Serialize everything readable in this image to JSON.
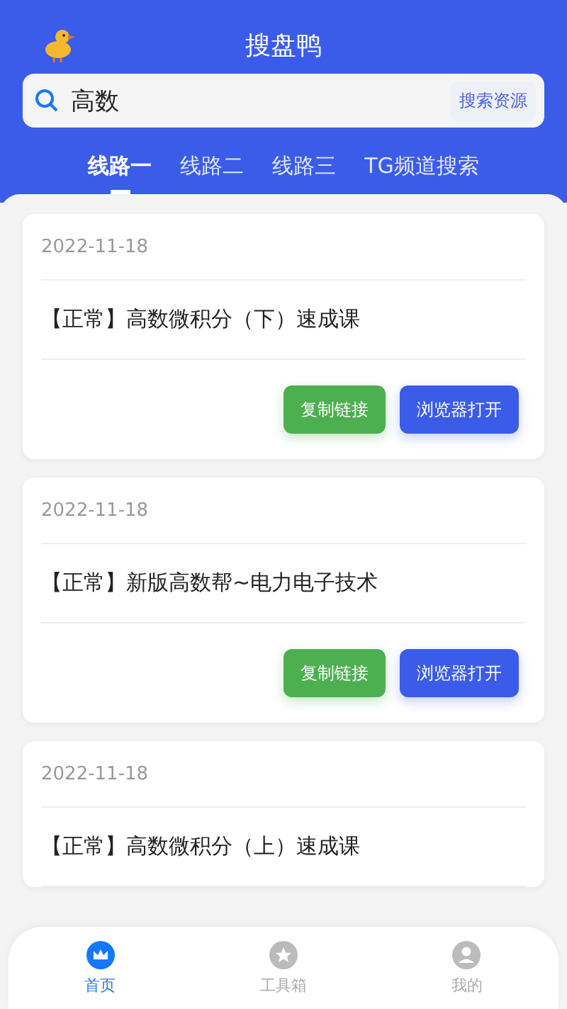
{
  "header": {
    "title": "搜盘鸭"
  },
  "search": {
    "value": "高数",
    "button": "搜索资源"
  },
  "tabs": [
    {
      "label": "线路一",
      "selected": true
    },
    {
      "label": "线路二",
      "selected": false
    },
    {
      "label": "线路三",
      "selected": false
    },
    {
      "label": "TG频道搜索",
      "selected": false
    }
  ],
  "results": [
    {
      "date": "2022-11-18",
      "title": "【正常】高数微积分（下）速成课",
      "buttons": [
        {
          "label": "复制链接",
          "kind": "copy"
        },
        {
          "label": "浏览器打开",
          "kind": "open"
        }
      ]
    },
    {
      "date": "2022-11-18",
      "title": "【正常】新版高数帮~电力电子技术",
      "buttons": [
        {
          "label": "复制链接",
          "kind": "copy"
        },
        {
          "label": "浏览器打开",
          "kind": "open"
        }
      ]
    },
    {
      "date": "2022-11-18",
      "title": "【正常】高数微积分（上）速成课"
    }
  ],
  "bottom_nav": [
    {
      "label": "首页",
      "kind": "crown",
      "selected": true
    },
    {
      "label": "工具箱",
      "kind": "star",
      "selected": false
    },
    {
      "label": "我的",
      "kind": "user",
      "selected": false
    }
  ]
}
